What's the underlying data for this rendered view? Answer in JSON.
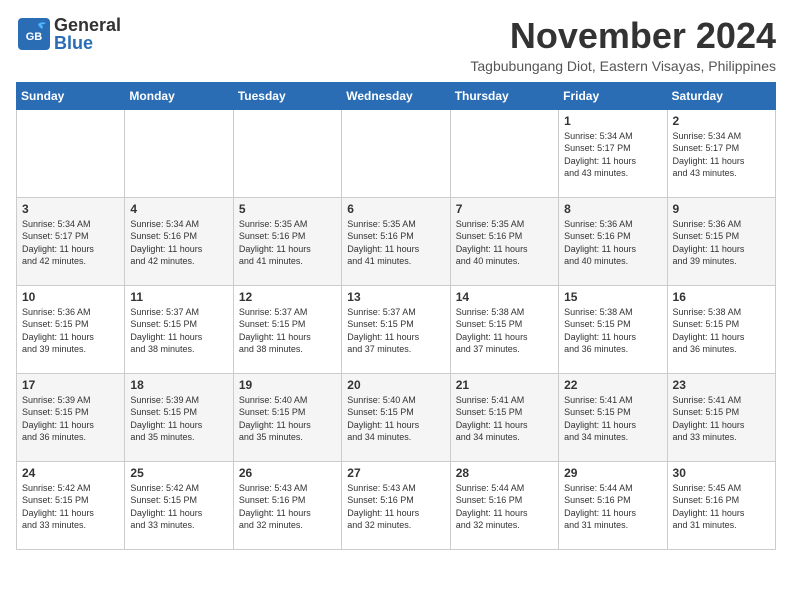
{
  "header": {
    "logo_general": "General",
    "logo_blue": "Blue",
    "month_title": "November 2024",
    "location": "Tagbubungang Diot, Eastern Visayas, Philippines"
  },
  "weekdays": [
    "Sunday",
    "Monday",
    "Tuesday",
    "Wednesday",
    "Thursday",
    "Friday",
    "Saturday"
  ],
  "weeks": [
    [
      {
        "day": "",
        "info": ""
      },
      {
        "day": "",
        "info": ""
      },
      {
        "day": "",
        "info": ""
      },
      {
        "day": "",
        "info": ""
      },
      {
        "day": "",
        "info": ""
      },
      {
        "day": "1",
        "info": "Sunrise: 5:34 AM\nSunset: 5:17 PM\nDaylight: 11 hours\nand 43 minutes."
      },
      {
        "day": "2",
        "info": "Sunrise: 5:34 AM\nSunset: 5:17 PM\nDaylight: 11 hours\nand 43 minutes."
      }
    ],
    [
      {
        "day": "3",
        "info": "Sunrise: 5:34 AM\nSunset: 5:17 PM\nDaylight: 11 hours\nand 42 minutes."
      },
      {
        "day": "4",
        "info": "Sunrise: 5:34 AM\nSunset: 5:16 PM\nDaylight: 11 hours\nand 42 minutes."
      },
      {
        "day": "5",
        "info": "Sunrise: 5:35 AM\nSunset: 5:16 PM\nDaylight: 11 hours\nand 41 minutes."
      },
      {
        "day": "6",
        "info": "Sunrise: 5:35 AM\nSunset: 5:16 PM\nDaylight: 11 hours\nand 41 minutes."
      },
      {
        "day": "7",
        "info": "Sunrise: 5:35 AM\nSunset: 5:16 PM\nDaylight: 11 hours\nand 40 minutes."
      },
      {
        "day": "8",
        "info": "Sunrise: 5:36 AM\nSunset: 5:16 PM\nDaylight: 11 hours\nand 40 minutes."
      },
      {
        "day": "9",
        "info": "Sunrise: 5:36 AM\nSunset: 5:15 PM\nDaylight: 11 hours\nand 39 minutes."
      }
    ],
    [
      {
        "day": "10",
        "info": "Sunrise: 5:36 AM\nSunset: 5:15 PM\nDaylight: 11 hours\nand 39 minutes."
      },
      {
        "day": "11",
        "info": "Sunrise: 5:37 AM\nSunset: 5:15 PM\nDaylight: 11 hours\nand 38 minutes."
      },
      {
        "day": "12",
        "info": "Sunrise: 5:37 AM\nSunset: 5:15 PM\nDaylight: 11 hours\nand 38 minutes."
      },
      {
        "day": "13",
        "info": "Sunrise: 5:37 AM\nSunset: 5:15 PM\nDaylight: 11 hours\nand 37 minutes."
      },
      {
        "day": "14",
        "info": "Sunrise: 5:38 AM\nSunset: 5:15 PM\nDaylight: 11 hours\nand 37 minutes."
      },
      {
        "day": "15",
        "info": "Sunrise: 5:38 AM\nSunset: 5:15 PM\nDaylight: 11 hours\nand 36 minutes."
      },
      {
        "day": "16",
        "info": "Sunrise: 5:38 AM\nSunset: 5:15 PM\nDaylight: 11 hours\nand 36 minutes."
      }
    ],
    [
      {
        "day": "17",
        "info": "Sunrise: 5:39 AM\nSunset: 5:15 PM\nDaylight: 11 hours\nand 36 minutes."
      },
      {
        "day": "18",
        "info": "Sunrise: 5:39 AM\nSunset: 5:15 PM\nDaylight: 11 hours\nand 35 minutes."
      },
      {
        "day": "19",
        "info": "Sunrise: 5:40 AM\nSunset: 5:15 PM\nDaylight: 11 hours\nand 35 minutes."
      },
      {
        "day": "20",
        "info": "Sunrise: 5:40 AM\nSunset: 5:15 PM\nDaylight: 11 hours\nand 34 minutes."
      },
      {
        "day": "21",
        "info": "Sunrise: 5:41 AM\nSunset: 5:15 PM\nDaylight: 11 hours\nand 34 minutes."
      },
      {
        "day": "22",
        "info": "Sunrise: 5:41 AM\nSunset: 5:15 PM\nDaylight: 11 hours\nand 34 minutes."
      },
      {
        "day": "23",
        "info": "Sunrise: 5:41 AM\nSunset: 5:15 PM\nDaylight: 11 hours\nand 33 minutes."
      }
    ],
    [
      {
        "day": "24",
        "info": "Sunrise: 5:42 AM\nSunset: 5:15 PM\nDaylight: 11 hours\nand 33 minutes."
      },
      {
        "day": "25",
        "info": "Sunrise: 5:42 AM\nSunset: 5:15 PM\nDaylight: 11 hours\nand 33 minutes."
      },
      {
        "day": "26",
        "info": "Sunrise: 5:43 AM\nSunset: 5:16 PM\nDaylight: 11 hours\nand 32 minutes."
      },
      {
        "day": "27",
        "info": "Sunrise: 5:43 AM\nSunset: 5:16 PM\nDaylight: 11 hours\nand 32 minutes."
      },
      {
        "day": "28",
        "info": "Sunrise: 5:44 AM\nSunset: 5:16 PM\nDaylight: 11 hours\nand 32 minutes."
      },
      {
        "day": "29",
        "info": "Sunrise: 5:44 AM\nSunset: 5:16 PM\nDaylight: 11 hours\nand 31 minutes."
      },
      {
        "day": "30",
        "info": "Sunrise: 5:45 AM\nSunset: 5:16 PM\nDaylight: 11 hours\nand 31 minutes."
      }
    ]
  ]
}
